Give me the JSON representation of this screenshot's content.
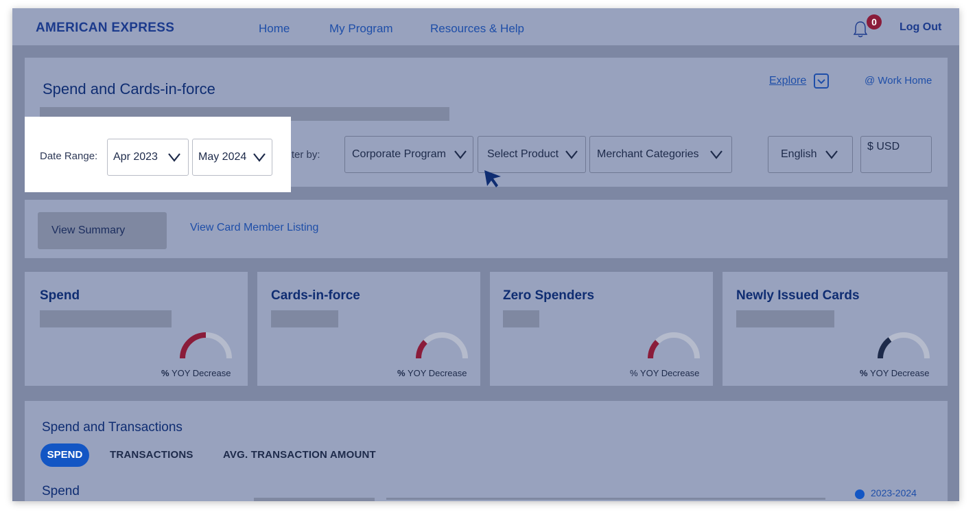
{
  "header": {
    "logo": "AMERICAN EXPRESS",
    "nav": [
      "Home",
      "My Program",
      "Resources & Help"
    ],
    "notification_count": "0",
    "logout": "Log Out"
  },
  "filters_panel": {
    "title": "Spend and Cards-in-force",
    "explore": "Explore",
    "work_home": "@ Work Home",
    "date_range_label": "Date Range:",
    "date_from": "Apr 2023",
    "date_to": "May 2024",
    "filter_label": "Filter by:",
    "filters": [
      "Corporate Program",
      "Select Product",
      "Merchant Categories"
    ],
    "language": "English",
    "currency": "$ USD"
  },
  "view_tabs": {
    "active": "View Summary",
    "other": "View Card Member Listing"
  },
  "cards": [
    {
      "title": "Spend",
      "yoy_pct": "%",
      "yoy_text": "YOY Decrease",
      "gauge_fraction": 0.5,
      "gauge_color": "#8a1c3a"
    },
    {
      "title": "Cards-in-force",
      "yoy_pct": "%",
      "yoy_text": "YOY Decrease",
      "gauge_fraction": 0.25,
      "gauge_color": "#8a1c3a"
    },
    {
      "title": "Zero Spenders",
      "yoy_pct": "",
      "yoy_text": "% YOY Decrease",
      "gauge_fraction": 0.25,
      "gauge_color": "#8a1c3a"
    },
    {
      "title": "Newly Issued Cards",
      "yoy_pct": "%",
      "yoy_text": "YOY Decrease",
      "gauge_fraction": 0.3,
      "gauge_color": "#1d2a4a"
    }
  ],
  "transactions": {
    "title": "Spend and Transactions",
    "tabs": [
      "SPEND",
      "TRANSACTIONS",
      "AVG. TRANSACTION AMOUNT"
    ],
    "subtitle": "Spend",
    "legend": "2023-2024"
  },
  "colors": {
    "brand": "#1b3a8c",
    "link": "#1e4ea8",
    "accent_red": "#8a1c3a",
    "pill_blue": "#1356c4",
    "overlay": "#98a2be"
  }
}
